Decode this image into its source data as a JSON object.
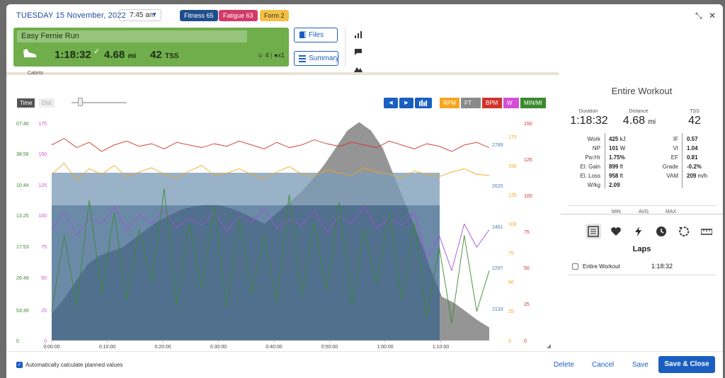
{
  "header": {
    "date": "TUESDAY 15 November, 2022",
    "time": "7:45 am",
    "fitness": "Fitness 65",
    "fatigue": "Fatigue 63",
    "form": "Form 2"
  },
  "workout": {
    "title": "Easy Fernie Run",
    "duration": "1:18:32",
    "distance": "4.68",
    "distance_unit": "mi",
    "tss": "42",
    "tss_unit": "TSS",
    "feel_count": "4",
    "comment_count": "x1"
  },
  "buttons": {
    "files": "Files",
    "summary": "Summary"
  },
  "map": {
    "label": "Cabrits"
  },
  "chart_controls": {
    "time": "Time",
    "dist": "Dist",
    "series_buttons": [
      {
        "label": "RPM",
        "color": "#f5a623"
      },
      {
        "label": "FT",
        "color": "#8a8a8a"
      },
      {
        "label": "BPM",
        "color": "#d0342c"
      },
      {
        "label": "W",
        "color": "#d44fd6"
      },
      {
        "label": "MIN/MI",
        "color": "#3a8a2e"
      }
    ]
  },
  "chart_data": {
    "type": "line",
    "x_ticks": [
      "0:00:00",
      "0:10:00",
      "0:20:00",
      "0:30:00",
      "0:40:00",
      "0:50:00",
      "1:00:00",
      "1:10:00"
    ],
    "axes": {
      "pace": {
        "ticks": [
          "07:40",
          "38:56",
          "10:44",
          "13:25",
          "17:53",
          "26:49",
          "53:39",
          "0"
        ],
        "color": "#3a8a2e"
      },
      "power": {
        "ticks": [
          "175",
          "150",
          "125",
          "100",
          "75",
          "50",
          "25",
          "0"
        ],
        "color": "#d44fd6"
      },
      "elevation": {
        "ticks": [
          "2789",
          "2625",
          "2461",
          "2297",
          "2133"
        ],
        "color": "#4a7fb5"
      },
      "cadence": {
        "ticks": [
          "175",
          "150",
          "125",
          "100",
          "75",
          "50",
          "25",
          "0"
        ],
        "color": "#f5a623"
      },
      "heart_rate": {
        "ticks": [
          "150",
          "125",
          "100",
          "75",
          "50",
          "25",
          "0"
        ],
        "color": "#d0342c"
      }
    },
    "series": [
      {
        "name": "FT",
        "color": "#8a8a8a",
        "values": [
          2133,
          2180,
          2240,
          2300,
          2330,
          2345,
          2360,
          2390,
          2420,
          2450,
          2470,
          2490,
          2500,
          2505,
          2505,
          2495,
          2480,
          2460,
          2440,
          2475,
          2510,
          2545,
          2590,
          2640,
          2700,
          2760,
          2789,
          2760,
          2700,
          2600,
          2500,
          2400,
          2290,
          2190,
          2170,
          2140,
          2110,
          2085
        ]
      },
      {
        "name": "BPM",
        "color": "#d0342c",
        "values": [
          150,
          155,
          148,
          152,
          145,
          150,
          153,
          149,
          151,
          147,
          152,
          150,
          148,
          151,
          149,
          153,
          150,
          147,
          152,
          148,
          150,
          154,
          151,
          149,
          152,
          150,
          148,
          153,
          150,
          147,
          151,
          149,
          145,
          150,
          152,
          148
        ]
      },
      {
        "name": "RPM",
        "color": "#f5a623",
        "values": [
          150,
          160,
          145,
          155,
          150,
          158,
          148,
          152,
          156,
          150,
          147,
          153,
          158,
          149,
          151,
          155,
          150,
          146,
          152,
          157,
          150,
          148,
          154,
          151,
          149,
          156,
          152,
          150,
          147,
          153,
          150,
          148,
          152,
          155,
          150,
          149
        ]
      },
      {
        "name": "W",
        "color": "#a44fd6",
        "values": [
          95,
          110,
          90,
          105,
          100,
          115,
          95,
          108,
          100,
          112,
          97,
          105,
          99,
          110,
          94,
          106,
          101,
          113,
          96,
          104,
          99,
          111,
          93,
          107,
          100,
          115,
          96,
          105,
          99,
          110,
          70,
          90,
          60,
          100,
          80,
          95
        ]
      },
      {
        "name": "MIN/MI",
        "color": "#3a8a2e",
        "values": [
          25,
          90,
          30,
          120,
          40,
          110,
          35,
          95,
          50,
          130,
          30,
          100,
          45,
          115,
          28,
          105,
          40,
          90,
          33,
          125,
          38,
          100,
          42,
          118,
          30,
          95,
          48,
          110,
          35,
          100,
          20,
          80,
          15,
          90,
          25,
          60
        ]
      }
    ]
  },
  "panel": {
    "title": "Entire Workout",
    "kpis": [
      {
        "label": "Duration",
        "value": "1:18:32",
        "unit": ""
      },
      {
        "label": "Distance",
        "value": "4.68",
        "unit": "mi"
      },
      {
        "label": "TSS",
        "value": "42",
        "unit": ""
      }
    ],
    "metrics_left": [
      {
        "label": "Work",
        "value": "425",
        "unit": "kJ"
      },
      {
        "label": "NP",
        "value": "101",
        "unit": "W"
      },
      {
        "label": "Pw:Hr",
        "value": "1.75%",
        "unit": ""
      },
      {
        "label": "El. Gain",
        "value": "899",
        "unit": "ft"
      },
      {
        "label": "El. Loss",
        "value": "958",
        "unit": "ft"
      },
      {
        "label": "W/kg",
        "value": "2.09",
        "unit": ""
      }
    ],
    "metrics_right": [
      {
        "label": "IF",
        "value": "0.57",
        "unit": ""
      },
      {
        "label": "VI",
        "value": "1.04",
        "unit": ""
      },
      {
        "label": "EF",
        "value": "0.81",
        "unit": ""
      },
      {
        "label": "Grade",
        "value": "-0.2%",
        "unit": ""
      },
      {
        "label": "VAM",
        "value": "209",
        "unit": "m/h"
      }
    ],
    "minmax_headers": [
      "MIN",
      "AVG",
      "MAX"
    ],
    "laps_title": "Laps",
    "lap_row": {
      "label": "Entire Workout",
      "value": "1:18:32"
    }
  },
  "footer": {
    "auto_calc": "Automatically calculate planned values",
    "delete": "Delete",
    "cancel": "Cancel",
    "save": "Save",
    "save_close": "Save & Close"
  }
}
